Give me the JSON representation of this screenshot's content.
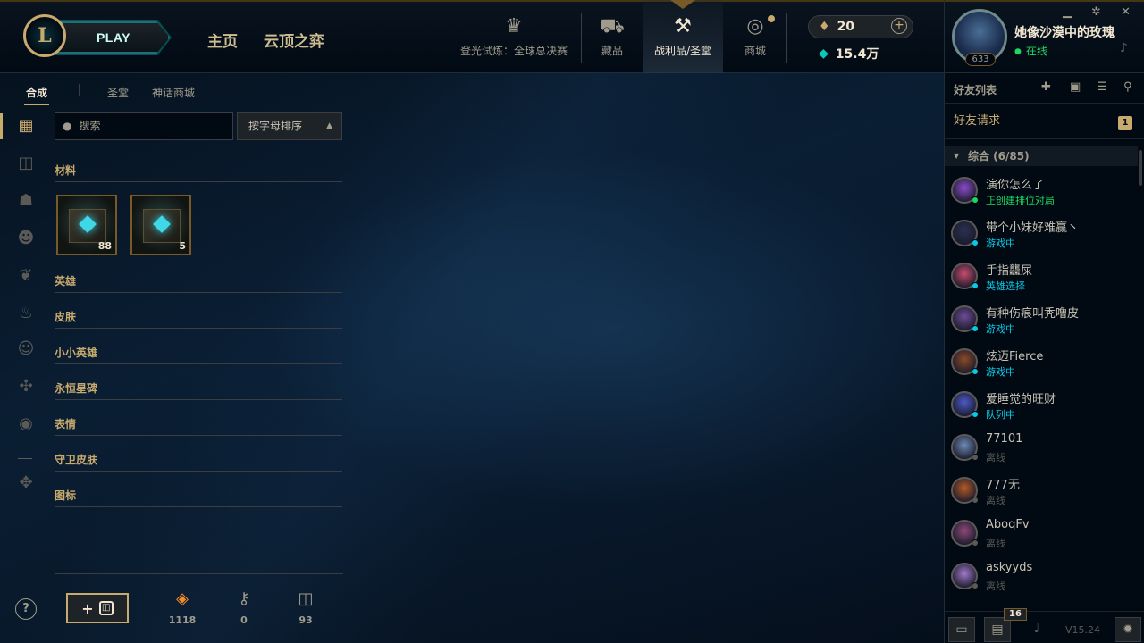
{
  "top_nav": {
    "play_label": "PLAY",
    "home": "主页",
    "tft": "云顶之弈",
    "worlds_event": "登光试炼：全球总决赛",
    "collection": "藏品",
    "loot": "战利品/圣堂",
    "store": "商城"
  },
  "currency": {
    "tokens": "20",
    "blue_essence": "15.4万"
  },
  "profile": {
    "name": "她像沙漠中的玫瑰",
    "status": "在线",
    "level": "633"
  },
  "crafting": {
    "tabs": [
      "合成",
      "圣堂",
      "神话商城"
    ],
    "search_placeholder": "搜索",
    "sort_label": "按字母排序",
    "categories": [
      "材料",
      "英雄",
      "皮肤",
      "小小英雄",
      "永恒星碑",
      "表情",
      "守卫皮肤",
      "图标"
    ],
    "materials": [
      {
        "name": "hextech-chest",
        "count": "88"
      },
      {
        "name": "hextech-key-chest",
        "count": "5"
      }
    ],
    "resources": [
      {
        "icon": "orange-essence-icon",
        "value": "1118",
        "color": "#f58c28"
      },
      {
        "icon": "key-icon",
        "value": "0",
        "color": "#a09b8c"
      },
      {
        "icon": "chest-icon",
        "value": "93",
        "color": "#a09b8c"
      }
    ],
    "help": "?"
  },
  "social": {
    "title": "好友列表",
    "friend_requests": "好友请求",
    "request_count": "1",
    "group": "综合 (6/85)",
    "friends": [
      {
        "name": "演你怎么了",
        "status": "正创建排位对局",
        "color": "#1ed760",
        "avatar": "#8a4cc8"
      },
      {
        "name": "带个小妹好难赢丶",
        "status": "游戏中",
        "color": "#0ac8e6",
        "avatar": "#2a3050"
      },
      {
        "name": "手指龘屎",
        "status": "英雄选择",
        "color": "#0ac8e6",
        "avatar": "#c84c6e"
      },
      {
        "name": "有种伤痕叫秃噜皮",
        "status": "游戏中",
        "color": "#0ac8e6",
        "avatar": "#6e4c96"
      },
      {
        "name": "炫迈Fierce",
        "status": "游戏中",
        "color": "#0ac8e6",
        "avatar": "#8c4a28"
      },
      {
        "name": "爱睡觉的旺财",
        "status": "队列中",
        "color": "#0ac8e6",
        "avatar": "#4c5ac8"
      },
      {
        "name": "77101",
        "status": "离线",
        "color": "#5b5a56",
        "avatar": "#6e8ab4"
      },
      {
        "name": "777无",
        "status": "离线",
        "color": "#5b5a56",
        "avatar": "#b45a28"
      },
      {
        "name": "AboqFv",
        "status": "离线",
        "color": "#5b5a56",
        "avatar": "#8c4a78"
      },
      {
        "name": "askyyds",
        "status": "离线",
        "color": "#5b5a56",
        "avatar": "#a078c8"
      }
    ],
    "footer_badge": "16",
    "version": "V15.24"
  }
}
